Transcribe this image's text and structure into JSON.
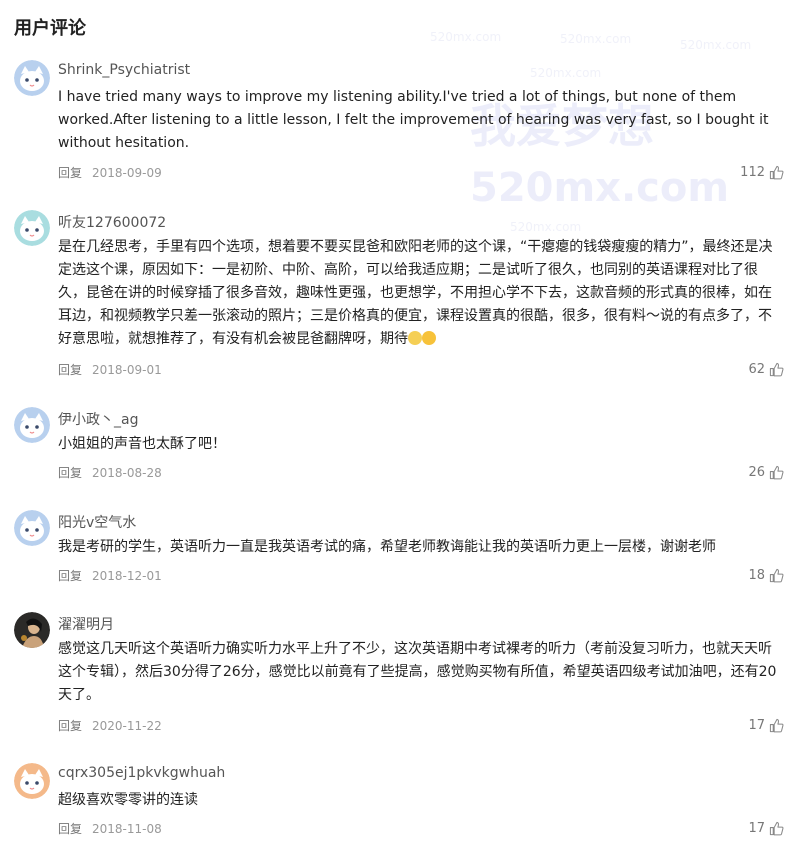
{
  "section_title": "用户评论",
  "watermark": {
    "big1": "我爱梦想",
    "big2": "520mx.com",
    "small": "520mx.com"
  },
  "comments": [
    {
      "username": "Shrink_Psychiatrist",
      "content": "I have tried many ways to improve my listening ability.I've tried a lot of things, but none of them worked.After listening to a little lesson, I felt the improvement of hearing was very fast, so I bought it without hesitation.",
      "reply_label": "回复",
      "date": "2018-09-09",
      "likes": "112"
    },
    {
      "username": "听友127600072",
      "content": "是在几经思考，手里有四个选项，想着要不要买昆爸和欧阳老师的这个课，“干瘪瘪的钱袋瘦瘦的精力”，最终还是决定选这个课，原因如下：一是初阶、中阶、高阶，可以给我适应期；二是试听了很久，也同别的英语课程对比了很久，昆爸在讲的时候穿插了很多音效，趣味性更强，也更想学，不用担心学不下去，这款音频的形式真的很棒，如在耳边，和视频教学只差一张滚动的照片；三是价格真的便宜，课程设置真的很酷，很多，很有料～说的有点多了，不好意思啦，就想推荐了，有没有机会被昆爸翻牌呀，期待",
      "reply_label": "回复",
      "date": "2018-09-01",
      "likes": "62"
    },
    {
      "username": "伊小政丶_ag",
      "content": "小姐姐的声音也太酥了吧！",
      "reply_label": "回复",
      "date": "2018-08-28",
      "likes": "26"
    },
    {
      "username": "阳光v空气水",
      "content": "我是考研的学生，英语听力一直是我英语考试的痛，希望老师教诲能让我的英语听力更上一层楼，谢谢老师",
      "reply_label": "回复",
      "date": "2018-12-01",
      "likes": "18"
    },
    {
      "username": "濯濯明月",
      "content": "感觉这几天听这个英语听力确实听力水平上升了不少，这次英语期中考试裸考的听力（考前没复习听力，也就天天听这个专辑），然后30分得了26分，感觉比以前竟有了些提高，感觉购买物有所值，希望英语四级考试加油吧，还有20天了。",
      "reply_label": "回复",
      "date": "2020-11-22",
      "likes": "17"
    },
    {
      "username": "cqrx305ej1pkvkgwhuah",
      "content": "超级喜欢零零讲的连读",
      "reply_label": "回复",
      "date": "2018-11-08",
      "likes": "17"
    }
  ]
}
